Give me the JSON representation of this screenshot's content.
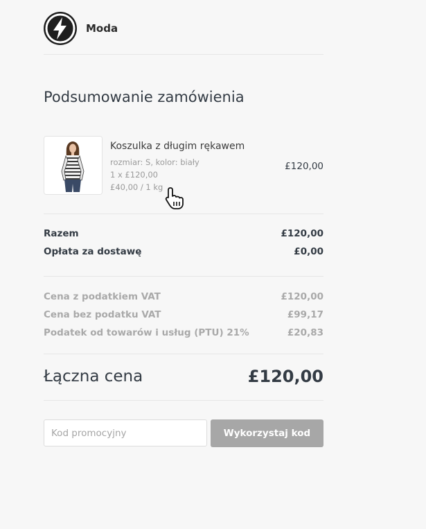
{
  "header": {
    "logo_icon": "lightning-bolt-icon",
    "brand_name": "Moda"
  },
  "summary": {
    "title": "Podsumowanie zamówienia"
  },
  "product": {
    "image": "woman-in-striped-long-sleeve-shirt",
    "name": "Koszulka z długim rękawem",
    "variant": "rozmiar: S, kolor: biały",
    "quantity_line": "1 x £120,00",
    "unit_price": "£40,00 / 1 kg",
    "price": "£120,00"
  },
  "totals": {
    "subtotal_label": "Razem",
    "subtotal_value": "£120,00",
    "shipping_label": "Opłata za dostawę",
    "shipping_value": "£0,00"
  },
  "tax": {
    "gross_label": "Cena z podatkiem VAT",
    "gross_value": "£120,00",
    "net_label": "Cena bez podatku VAT",
    "net_value": "£99,17",
    "vat_label": "Podatek od towarów i usług (PTU) 21%",
    "vat_value": "£20,83"
  },
  "grand_total": {
    "label": "Łączna cena",
    "value": "£120,00"
  },
  "promo": {
    "placeholder": "Kod promocyjny",
    "value": "",
    "button_label": "Wykorzystaj kod"
  },
  "colors": {
    "background": "#f7f7f7",
    "text_dark": "#333b44",
    "text_muted": "#a9a9a9",
    "button_bg": "#a7a7a7"
  }
}
